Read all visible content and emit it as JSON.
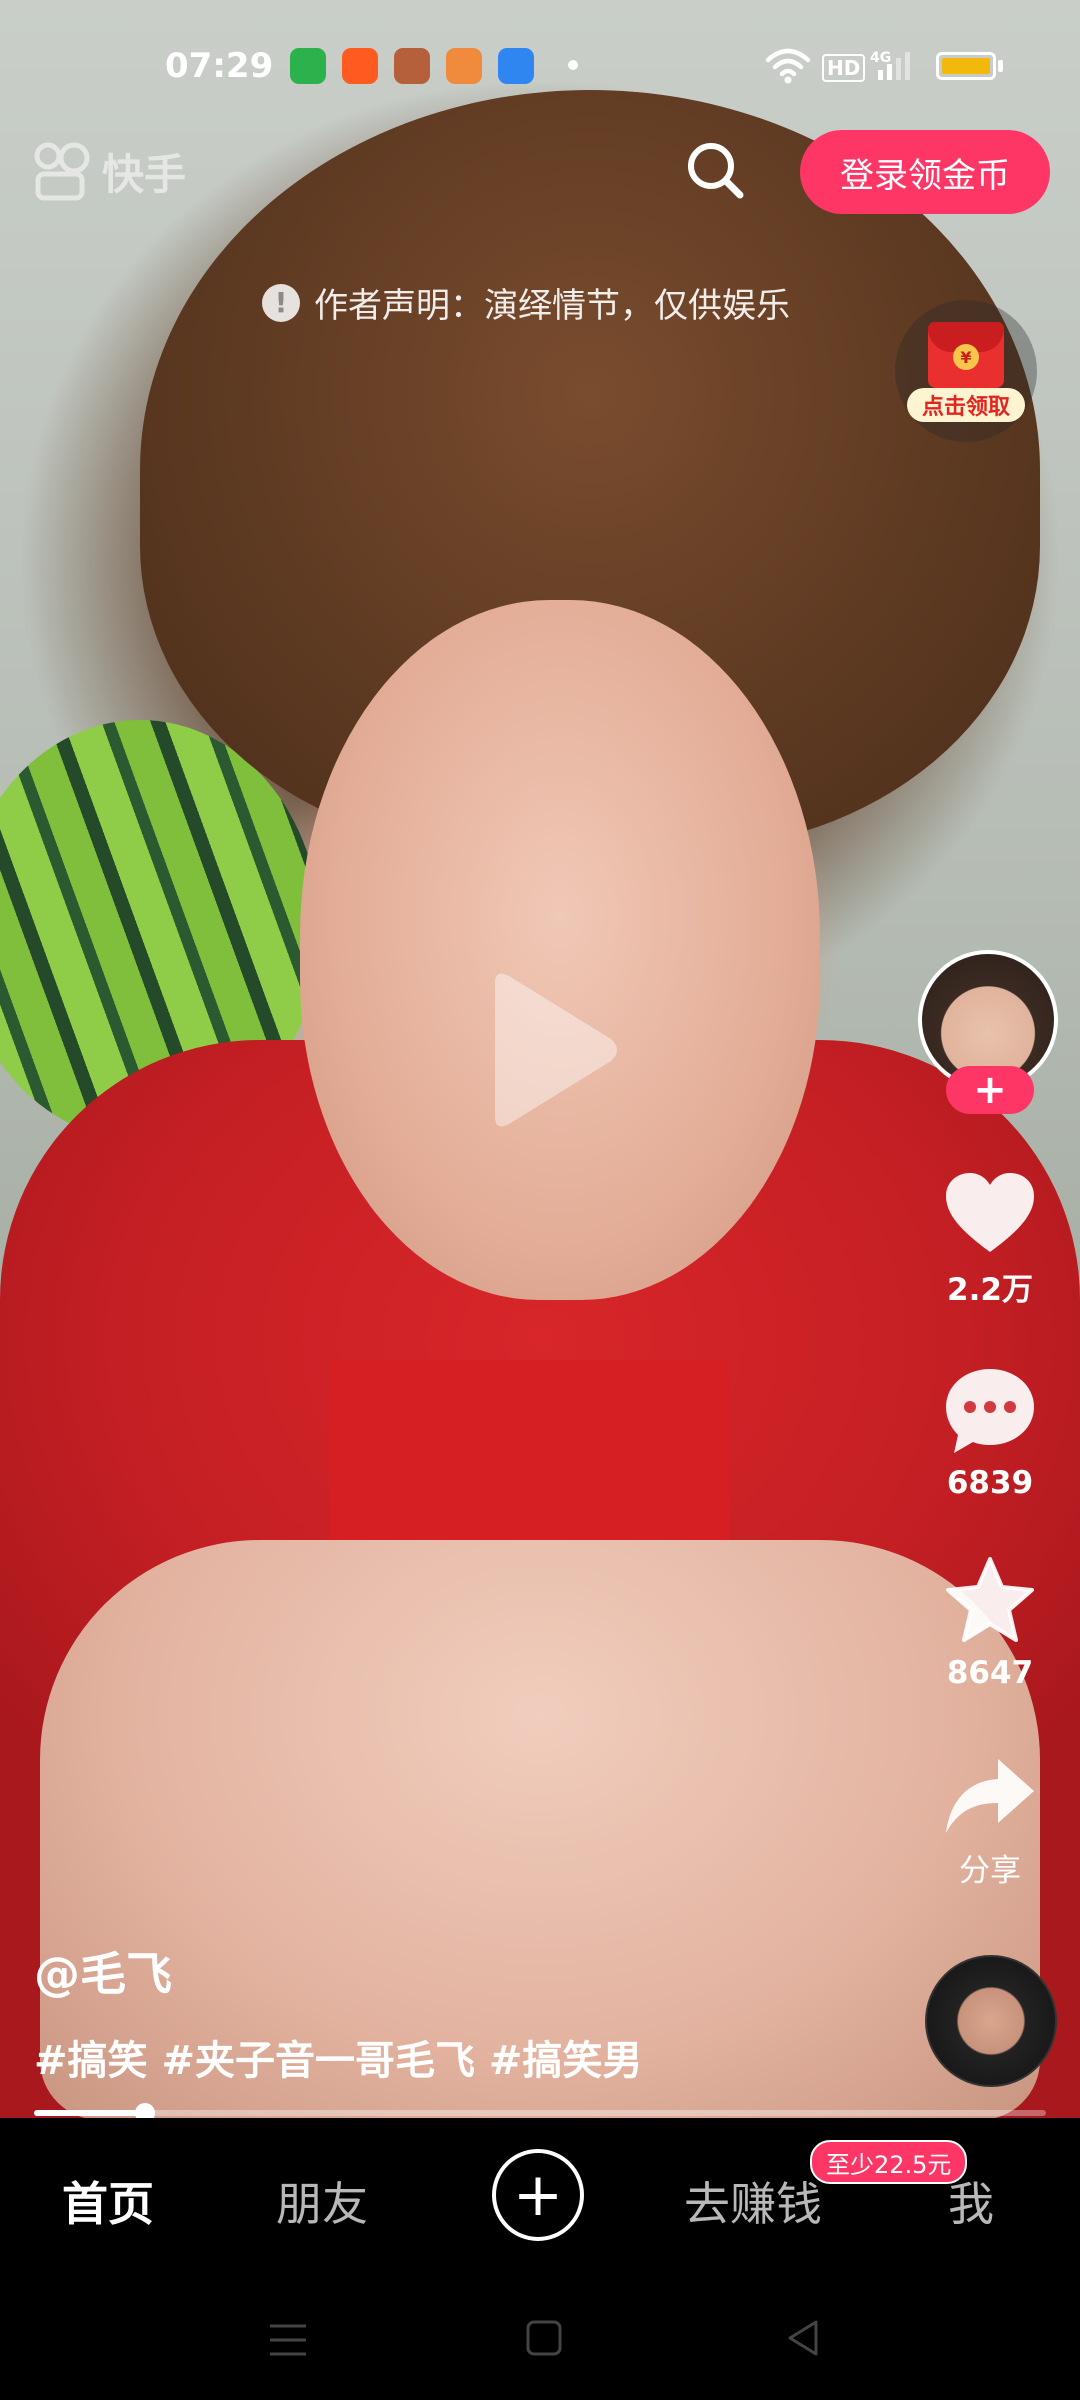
{
  "status_bar": {
    "time": "07:29",
    "app_icons": [
      "app-icon-green",
      "app-icon-kuaishou",
      "app-icon-game",
      "app-icon-gamepad",
      "app-icon-blue"
    ],
    "network_label": "HD",
    "network_type": "4G",
    "icons": [
      "wifi-icon",
      "signal-icon",
      "battery-icon"
    ]
  },
  "top_bar": {
    "logo_text": "快手",
    "login_button": "登录领金币",
    "search_icon": "search-icon"
  },
  "disclaimer": {
    "icon": "exclamation-icon",
    "text": "作者声明：演绎情节，仅供娱乐"
  },
  "red_packet": {
    "label": "点击领取",
    "coin_symbol": "¥"
  },
  "actions": {
    "follow_symbol": "+",
    "like_count": "2.2万",
    "comment_count": "6839",
    "collect_count": "8647",
    "share_label": "分享"
  },
  "caption": {
    "author": "@毛飞",
    "hashtags": "#搞笑 #夹子音一哥毛飞 #搞笑男"
  },
  "progress": 0.11,
  "bottom_nav": {
    "home": "首页",
    "friends": "朋友",
    "plus": "+",
    "earn": "去赚钱",
    "earn_badge": "至少22.5元",
    "me": "我"
  },
  "colors": {
    "accent": "#fe3666",
    "battery": "#f2b90c"
  }
}
